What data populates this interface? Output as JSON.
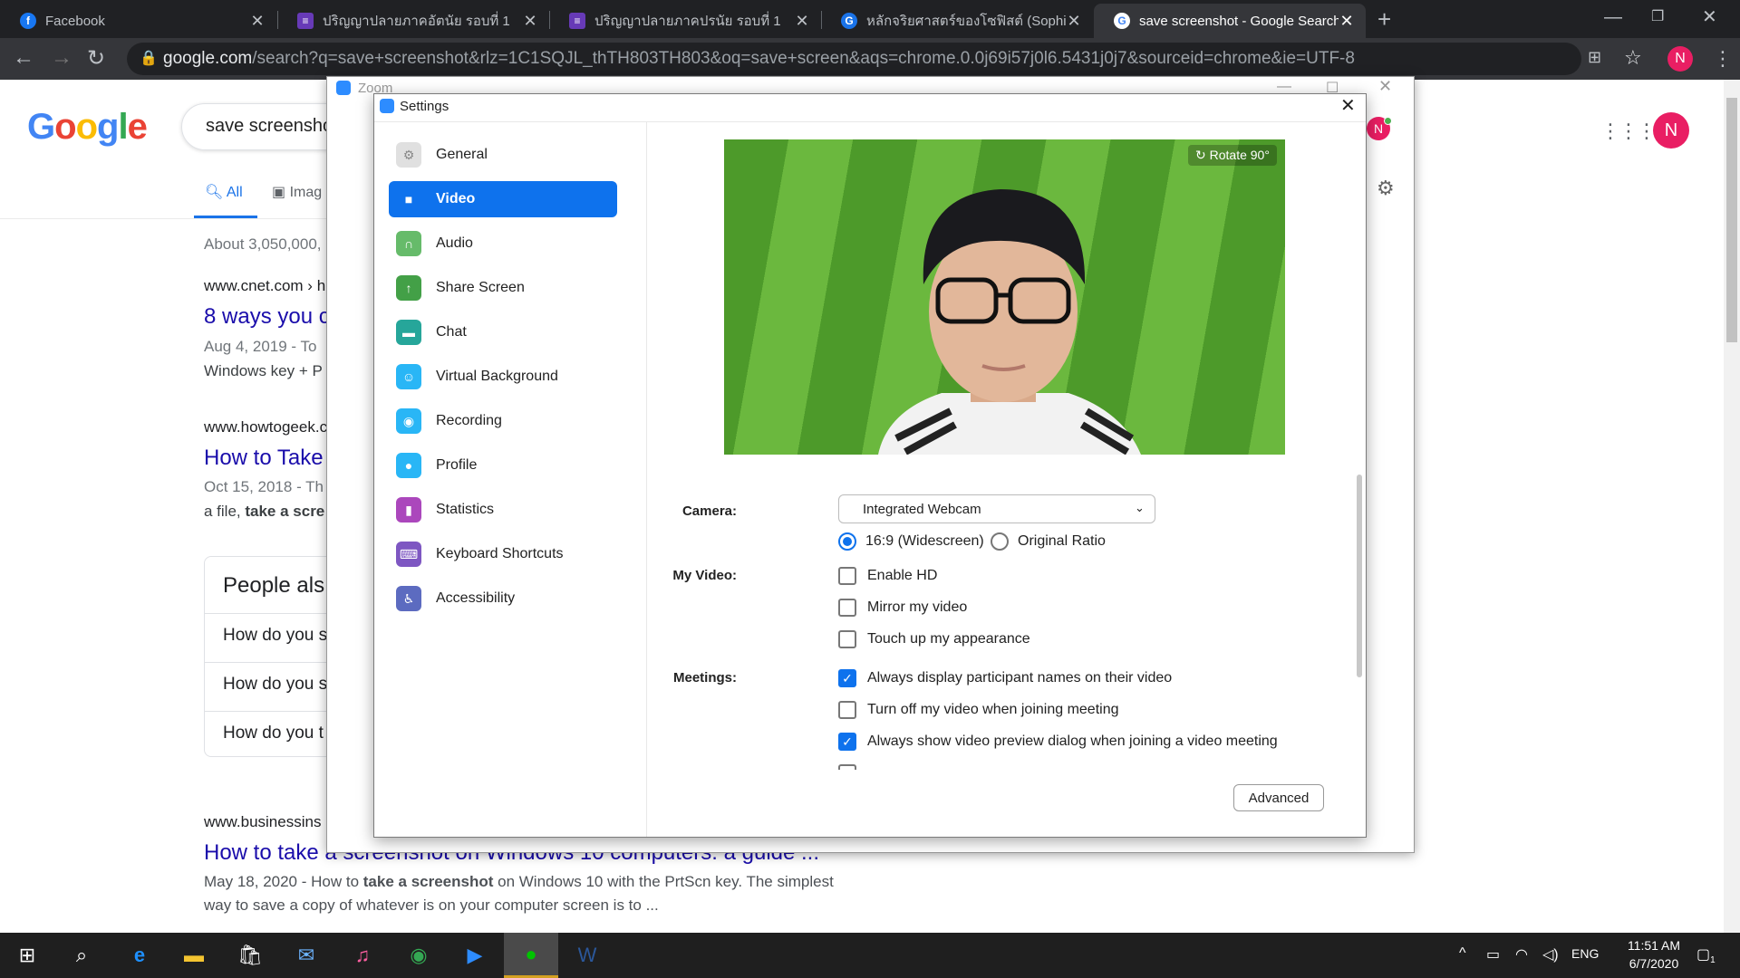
{
  "tabs": [
    {
      "title": "Facebook",
      "favicon": "facebook-icon",
      "color": "#1877f2",
      "glyph": "f"
    },
    {
      "title": "ปริญญาปลายภาคอัตนัย รอบที่ 1",
      "favicon": "forms-icon",
      "color": "#673ab7",
      "glyph": "≡"
    },
    {
      "title": "ปริญญาปลายภาคปรนัย รอบที่ 1",
      "favicon": "forms-icon",
      "color": "#673ab7",
      "glyph": "≡"
    },
    {
      "title": "หลักจริยศาสตร์ของโซฟิสต์ (Sophist)",
      "favicon": "site-icon",
      "color": "#1a73e8",
      "glyph": "G"
    },
    {
      "title": "save screenshot - Google Search",
      "favicon": "google-icon",
      "color": "#ffffff",
      "glyph": "G"
    }
  ],
  "address": {
    "domain": "google.com",
    "path": "/search?q=save+screenshot&rlz=1C1SQJL_thTH803TH803&oq=save+screen&aqs=chrome.0.0j69i57j0l6.5431j0j7&sourceid=chrome&ie=UTF-8"
  },
  "profile_initial": "N",
  "google": {
    "logo": "Google",
    "query": "save screensho",
    "tab_all": "All",
    "tab_images": "Imag",
    "stats": "About 3,050,000,",
    "results": [
      {
        "cite": "www.cnet.com › h",
        "title": "8 ways you c",
        "date": "Aug 4, 2019 - To",
        "snippet": "Windows key + P"
      },
      {
        "cite": "www.howtogeek.c",
        "title": "How to Take",
        "date": "Oct 15, 2018 - Th",
        "snippet_plain": "a file, ",
        "snippet_bold": "take a scre"
      }
    ],
    "people_also_ask": {
      "heading": "People als",
      "questions": [
        "How do you s",
        "How do you s",
        "How do you t"
      ]
    },
    "bottom_result": {
      "cite": "www.businessins",
      "title": "How to take a screenshot on Windows 10 computers: a guide ...",
      "line1_a": "May 18, 2020 - How to ",
      "line1_b": "take a screenshot",
      "line1_c": " on Windows 10 with the PrtScn key. The simplest",
      "line2": "way to save a copy of whatever is on your computer screen is to ..."
    }
  },
  "zoom_title": "Zoom",
  "settings": {
    "title": "Settings",
    "nav": [
      {
        "label": "General",
        "icon": "gear-icon",
        "color": "#9e9e9e",
        "glyph": "⚙"
      },
      {
        "label": "Video",
        "icon": "video-camera-icon",
        "color": "#0e72ed",
        "glyph": "■"
      },
      {
        "label": "Audio",
        "icon": "headphones-icon",
        "color": "#4caf50",
        "glyph": "∩"
      },
      {
        "label": "Share Screen",
        "icon": "share-screen-icon",
        "color": "#43a047",
        "glyph": "↑"
      },
      {
        "label": "Chat",
        "icon": "chat-icon",
        "color": "#26a69a",
        "glyph": "▬"
      },
      {
        "label": "Virtual Background",
        "icon": "virtual-background-icon",
        "color": "#29b6f6",
        "glyph": "☺"
      },
      {
        "label": "Recording",
        "icon": "recording-icon",
        "color": "#29b6f6",
        "glyph": "◉"
      },
      {
        "label": "Profile",
        "icon": "profile-icon",
        "color": "#29b6f6",
        "glyph": "●"
      },
      {
        "label": "Statistics",
        "icon": "statistics-icon",
        "color": "#ab47bc",
        "glyph": "▮"
      },
      {
        "label": "Keyboard Shortcuts",
        "icon": "keyboard-icon",
        "color": "#7e57c2",
        "glyph": "⌨"
      },
      {
        "label": "Accessibility",
        "icon": "accessibility-icon",
        "color": "#5c6bc0",
        "glyph": "♿"
      }
    ],
    "rotate": "Rotate 90°",
    "camera_label": "Camera:",
    "camera_value": "Integrated Webcam",
    "ratio_widescreen": "16:9 (Widescreen)",
    "ratio_original": "Original Ratio",
    "my_video_label": "My Video:",
    "enable_hd": "Enable HD",
    "mirror": "Mirror my video",
    "touch_up": "Touch up my appearance",
    "meetings_label": "Meetings:",
    "always_names": "Always display participant names on their video",
    "turn_off_video": "Turn off my video when joining meeting",
    "always_preview": "Always show video preview dialog when joining a video meeting",
    "advanced": "Advanced"
  },
  "taskbar": {
    "lang": "ENG",
    "time": "11:51 AM",
    "date": "6/7/2020",
    "notif_count": "1"
  }
}
